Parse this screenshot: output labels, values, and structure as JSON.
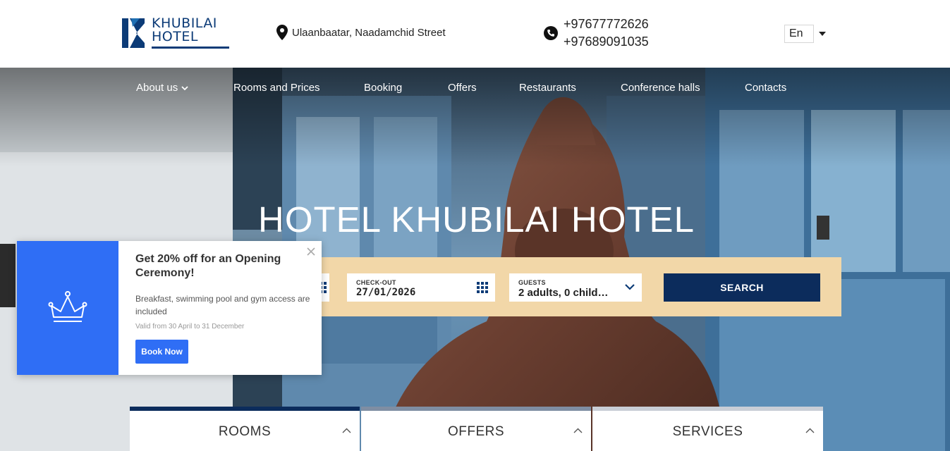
{
  "header": {
    "logo": {
      "line1": "KHUBILAI",
      "line2": "HOTEL",
      "brand_color": "#0c3b77"
    },
    "address": {
      "icon": "map-pin-icon",
      "text": "Ulaanbaatar, Naadamchid Street"
    },
    "phones": {
      "icon": "phone-icon",
      "numbers": [
        "+97677772626",
        "+97689091035"
      ]
    },
    "language": {
      "selected": "En"
    }
  },
  "nav": {
    "items": [
      {
        "label": "About us",
        "has_dropdown": true
      },
      {
        "label": "Rooms and Prices"
      },
      {
        "label": "Booking"
      },
      {
        "label": "Offers"
      },
      {
        "label": "Restaurants"
      },
      {
        "label": "Conference halls"
      },
      {
        "label": "Contacts"
      }
    ]
  },
  "hero": {
    "title": "HOTEL KHUBILAI HOTEL"
  },
  "booking": {
    "checkout": {
      "label": "CHECK-OUT",
      "value": "27/01/2026",
      "icon": "calendar-grid-icon"
    },
    "guests": {
      "label": "GUESTS",
      "value": "2 adults, 0 child…",
      "icon": "chevron-down-icon"
    },
    "search_label": "SEARCH",
    "panel_color": "#f2d7a8",
    "button_color": "#0c2c5c"
  },
  "tabs": [
    {
      "label": "ROOMS",
      "bar_color": "#0c2c5c",
      "icon": "chevron-up-icon"
    },
    {
      "label": "OFFERS",
      "bar_color": "#7f8ea3",
      "icon": "chevron-up-icon"
    },
    {
      "label": "SERVICES",
      "bar_color": "#c9ced6",
      "icon": "chevron-up-icon"
    }
  ],
  "popup": {
    "icon": "crown-icon",
    "title": "Get 20% off for an Opening Ceremony!",
    "description": "Breakfast, swimming pool and gym access are included",
    "validity": "Valid from 30 April to 31 December",
    "button_label": "Book Now",
    "close_icon": "close-icon",
    "accent_color": "#2f6ef5"
  }
}
